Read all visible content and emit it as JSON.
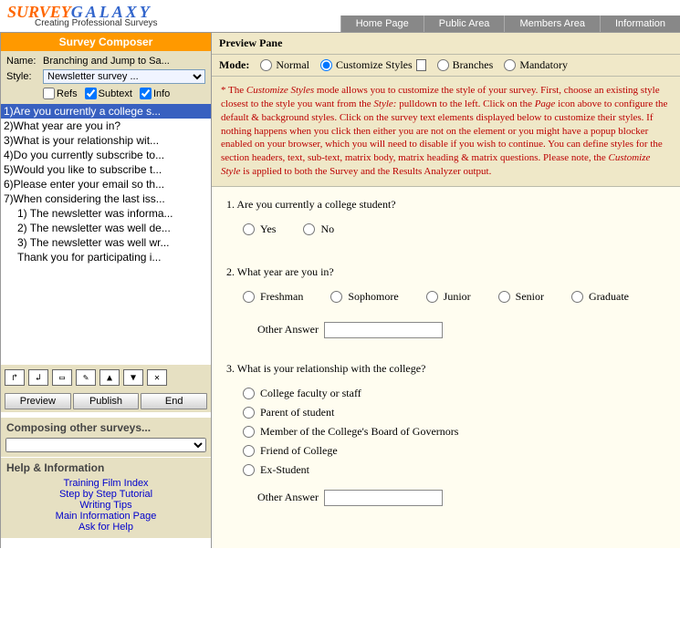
{
  "header": {
    "logo": {
      "part1": "SURVEY",
      "part2": "GALAXY"
    },
    "tagline": "Creating Professional Surveys",
    "nav": [
      "Home Page",
      "Public Area",
      "Members Area",
      "Information"
    ]
  },
  "composer": {
    "title": "Survey Composer",
    "name_label": "Name:",
    "name_value": "Branching and Jump to Sa...",
    "style_label": "Style:",
    "style_value": "Newsletter survey ...",
    "checks": {
      "refs": "Refs",
      "subtext": "Subtext",
      "info": "Info"
    },
    "questions": [
      "1)Are you currently a college s...",
      "2)What year are you in?",
      "3)What is your relationship wit...",
      "4)Do you currently subscribe to...",
      "5)Would you like to subscribe t...",
      "6)Please enter your email so th...",
      "7)When considering the last iss..."
    ],
    "subs": [
      "1) The newsletter was informa...",
      "2) The newsletter was well de...",
      "3) The newsletter was well wr...",
      "   Thank you for participating i..."
    ],
    "buttons": {
      "preview": "Preview",
      "publish": "Publish",
      "end": "End"
    },
    "compose_other": "Composing other surveys...",
    "help_title": "Help & Information",
    "help_links": [
      "Training Film Index",
      "Step by Step Tutorial",
      "Writing Tips",
      "Main Information Page",
      "Ask for Help"
    ]
  },
  "preview": {
    "pane_title": "Preview Pane",
    "mode_label": "Mode:",
    "modes": {
      "normal": "Normal",
      "customize": "Customize Styles",
      "branches": "Branches",
      "mandatory": "Mandatory"
    },
    "note_prefix": "* The ",
    "note_i1": "Customize Styles",
    "note_mid1": " mode allows you to customize the style of your survey. First, choose an existing style closest to the style you want from the ",
    "note_i2": "Style:",
    "note_mid2": " pulldown to the left. Click on the ",
    "note_i3": "Page",
    "note_mid3": " icon above to configure the default & background styles. Click on the survey text elements displayed below to customize their styles. If nothing happens when you click then either you are not on the element or you might have a popup blocker enabled on your browser, which you will need to disable if you wish to continue. You can define styles for the section headers, text, sub-text, matrix body, matrix heading & matrix questions. Please note, the ",
    "note_i4": "Customize Style",
    "note_end": " is applied to both the Survey and the Results Analyzer output.",
    "q1": {
      "text": "1.  Are you currently a college student?",
      "opts": [
        "Yes",
        "No"
      ]
    },
    "q2": {
      "text": "2.  What year are you in?",
      "opts": [
        "Freshman",
        "Sophomore",
        "Junior",
        "Senior",
        "Graduate"
      ],
      "other": "Other Answer"
    },
    "q3": {
      "text": "3.  What is your relationship with the college?",
      "opts": [
        "College faculty or staff",
        "Parent of student",
        "Member of the College's Board of Governors",
        "Friend of College",
        "Ex-Student"
      ],
      "other": "Other Answer"
    }
  }
}
